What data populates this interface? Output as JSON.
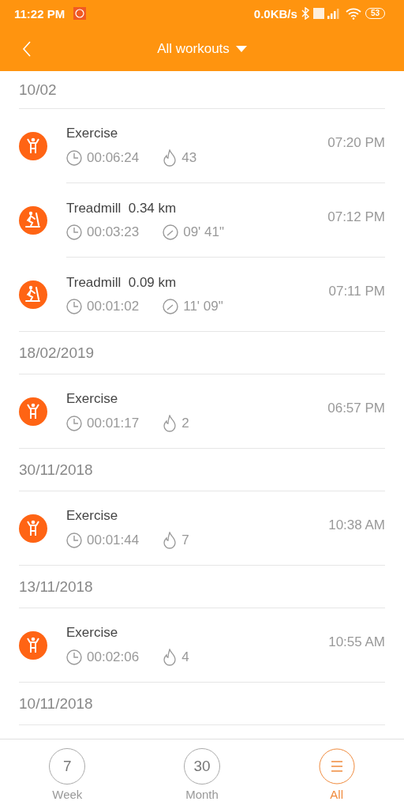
{
  "status_bar": {
    "time": "11:22 PM",
    "speed": "0.0KB/s",
    "battery": "53"
  },
  "header": {
    "title": "All workouts"
  },
  "groups": [
    {
      "date": "10/02",
      "workouts": [
        {
          "kind": "exercise",
          "name": "Exercise",
          "duration": "00:06:24",
          "stat": "43",
          "time": "07:20 PM"
        },
        {
          "kind": "treadmill",
          "name": "Treadmill",
          "distance": "0.34 km",
          "duration": "00:03:23",
          "stat": "09' 41\"",
          "time": "07:12 PM"
        },
        {
          "kind": "treadmill",
          "name": "Treadmill",
          "distance": "0.09 km",
          "duration": "00:01:02",
          "stat": "11' 09\"",
          "time": "07:11 PM"
        }
      ]
    },
    {
      "date": "18/02/2019",
      "workouts": [
        {
          "kind": "exercise",
          "name": "Exercise",
          "duration": "00:01:17",
          "stat": "2",
          "time": "06:57 PM"
        }
      ]
    },
    {
      "date": "30/11/2018",
      "workouts": [
        {
          "kind": "exercise",
          "name": "Exercise",
          "duration": "00:01:44",
          "stat": "7",
          "time": "10:38 AM"
        }
      ]
    },
    {
      "date": "13/11/2018",
      "workouts": [
        {
          "kind": "exercise",
          "name": "Exercise",
          "duration": "00:02:06",
          "stat": "4",
          "time": "10:55 AM"
        }
      ]
    },
    {
      "date": "10/11/2018"
    }
  ],
  "tabs": [
    {
      "kind": "number",
      "number": "7",
      "label": "Week",
      "selected": false
    },
    {
      "kind": "number",
      "number": "30",
      "label": "Month",
      "selected": false
    },
    {
      "kind": "menu",
      "label": "All",
      "selected": true
    }
  ]
}
